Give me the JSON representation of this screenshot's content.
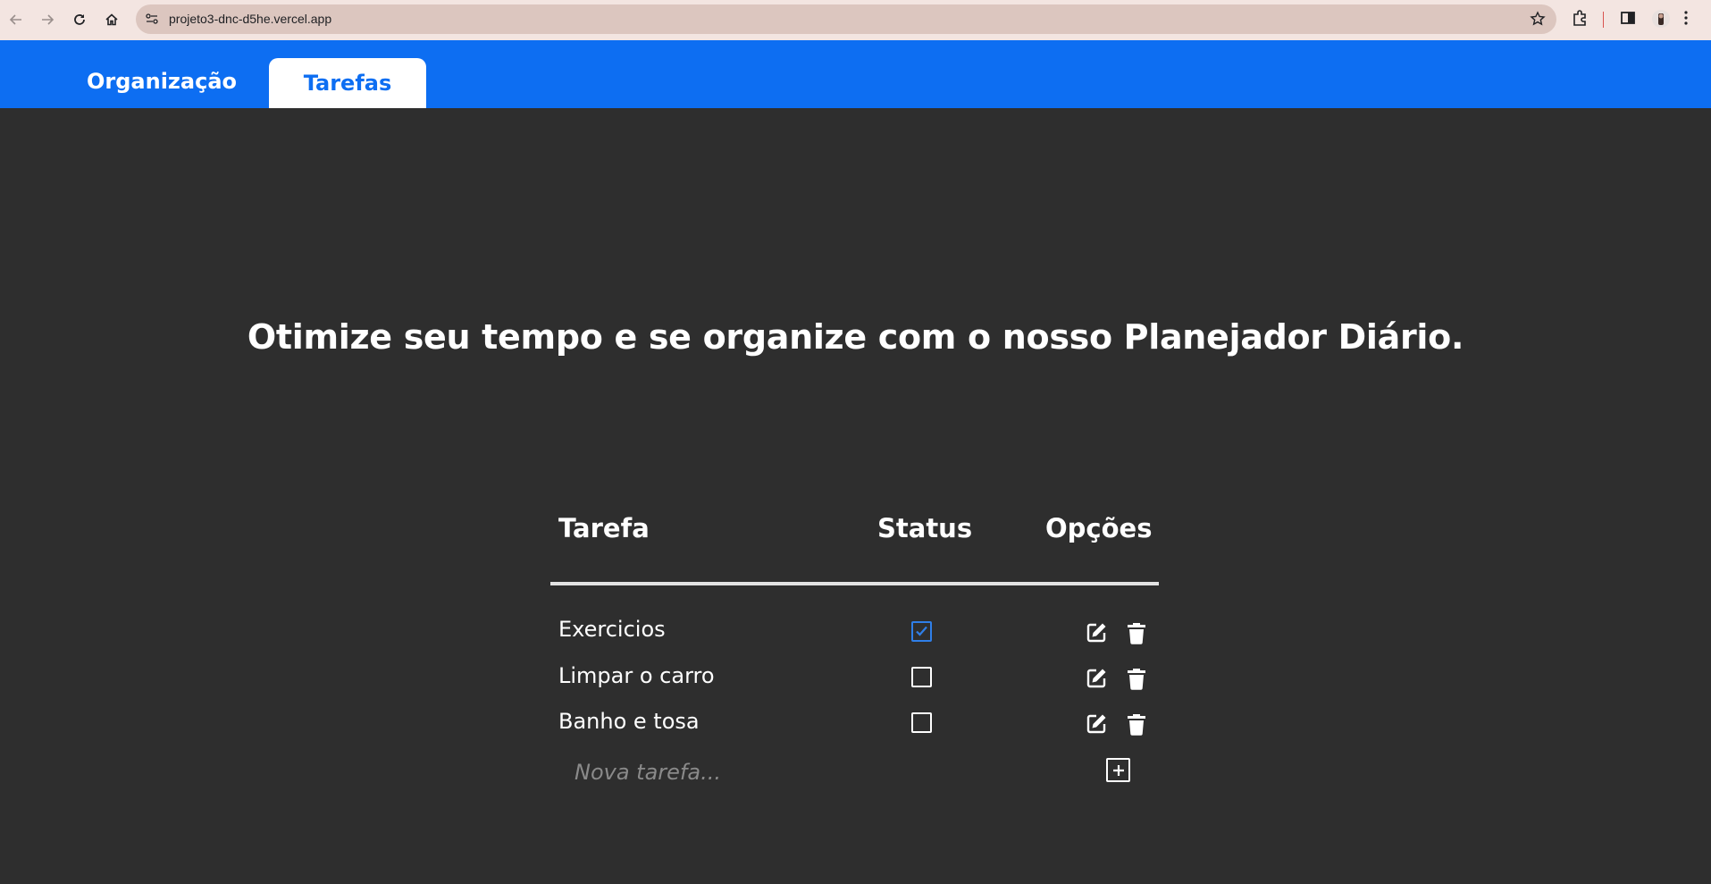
{
  "browser": {
    "url": "projeto3-dnc-d5he.vercel.app"
  },
  "nav": {
    "tabs": [
      {
        "label": "Organização",
        "active": false
      },
      {
        "label": "Tarefas",
        "active": true
      }
    ]
  },
  "main": {
    "headline": "Otimize seu tempo e se organize com o nosso Planejador Diário."
  },
  "table": {
    "headers": {
      "task": "Tarefa",
      "status": "Status",
      "options": "Opções"
    },
    "rows": [
      {
        "name": "Exercicios",
        "done": true
      },
      {
        "name": "Limpar o carro",
        "done": false
      },
      {
        "name": "Banho e tosa",
        "done": false
      }
    ],
    "new_task_placeholder": "Nova tarefa..."
  },
  "colors": {
    "header_blue": "#0d6ef2",
    "background": "#2e2e2e",
    "checked_blue": "#2f7fe8"
  },
  "icons": {
    "edit": "edit-icon",
    "delete": "trash-icon",
    "add": "plus-square-icon",
    "checked": "check-square-icon"
  }
}
